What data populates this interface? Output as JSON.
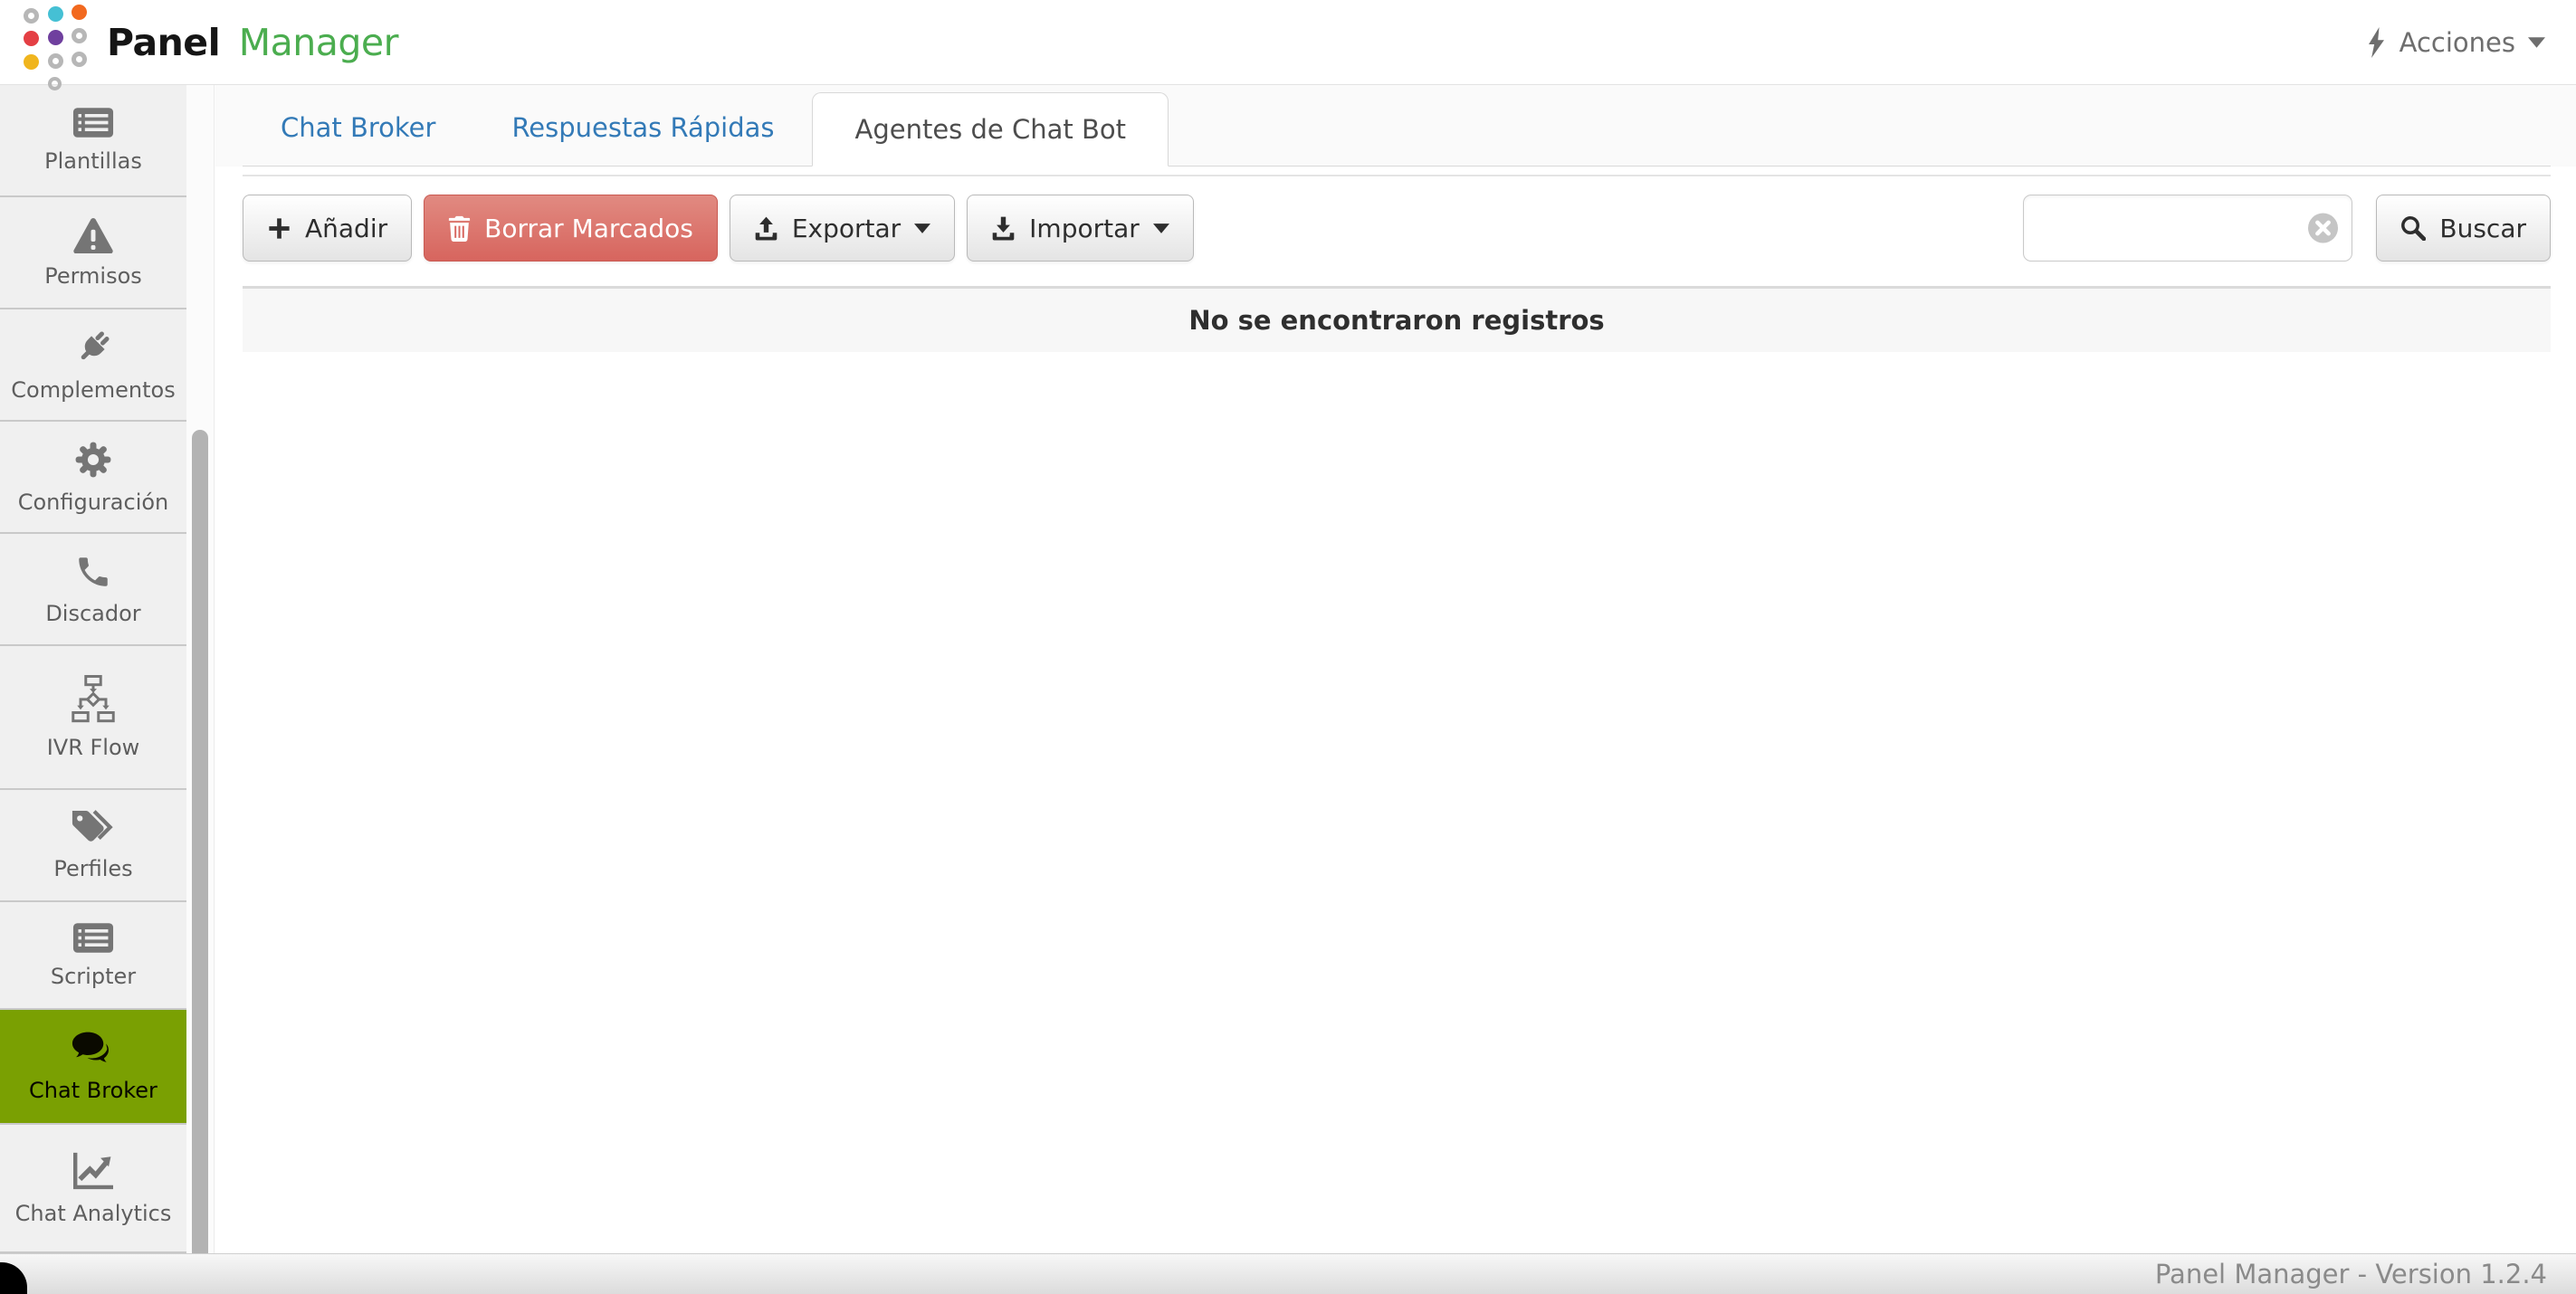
{
  "app": {
    "brand_primary": "Panel",
    "brand_secondary": "Manager",
    "footer_text": "Panel Manager - Version 1.2.4"
  },
  "header": {
    "actions_label": "Acciones"
  },
  "sidebar": {
    "items": [
      {
        "label": "Plantillas",
        "icon": "templates-icon",
        "active": false
      },
      {
        "label": "Permisos",
        "icon": "warning-icon",
        "active": false
      },
      {
        "label": "Complementos",
        "icon": "plug-icon",
        "active": false
      },
      {
        "label": "Configuración",
        "icon": "gear-icon",
        "active": false
      },
      {
        "label": "Discador",
        "icon": "phone-icon",
        "active": false
      },
      {
        "label": "IVR Flow",
        "icon": "flowchart-icon",
        "active": false
      },
      {
        "label": "Perfiles",
        "icon": "tags-icon",
        "active": false
      },
      {
        "label": "Scripter",
        "icon": "script-list-icon",
        "active": false
      },
      {
        "label": "Chat Broker",
        "icon": "chat-bubbles-icon",
        "active": true
      },
      {
        "label": "Chat Analytics",
        "icon": "chart-line-icon",
        "active": false
      }
    ]
  },
  "tabs": [
    {
      "label": "Chat Broker",
      "active": false
    },
    {
      "label": "Respuestas Rápidas",
      "active": false
    },
    {
      "label": "Agentes de Chat Bot",
      "active": true
    }
  ],
  "toolbar": {
    "add_label": "Añadir",
    "delete_label": "Borrar Marcados",
    "export_label": "Exportar",
    "import_label": "Importar",
    "search_value": "",
    "search_placeholder": "",
    "search_button_label": "Buscar"
  },
  "content": {
    "empty_message": "No se encontraron registros"
  },
  "colors": {
    "active_sidebar_bg": "#7aa002",
    "danger_button": "#d7655e",
    "tab_link_blue": "#337ab7",
    "brand_green": "#4bad4f"
  }
}
